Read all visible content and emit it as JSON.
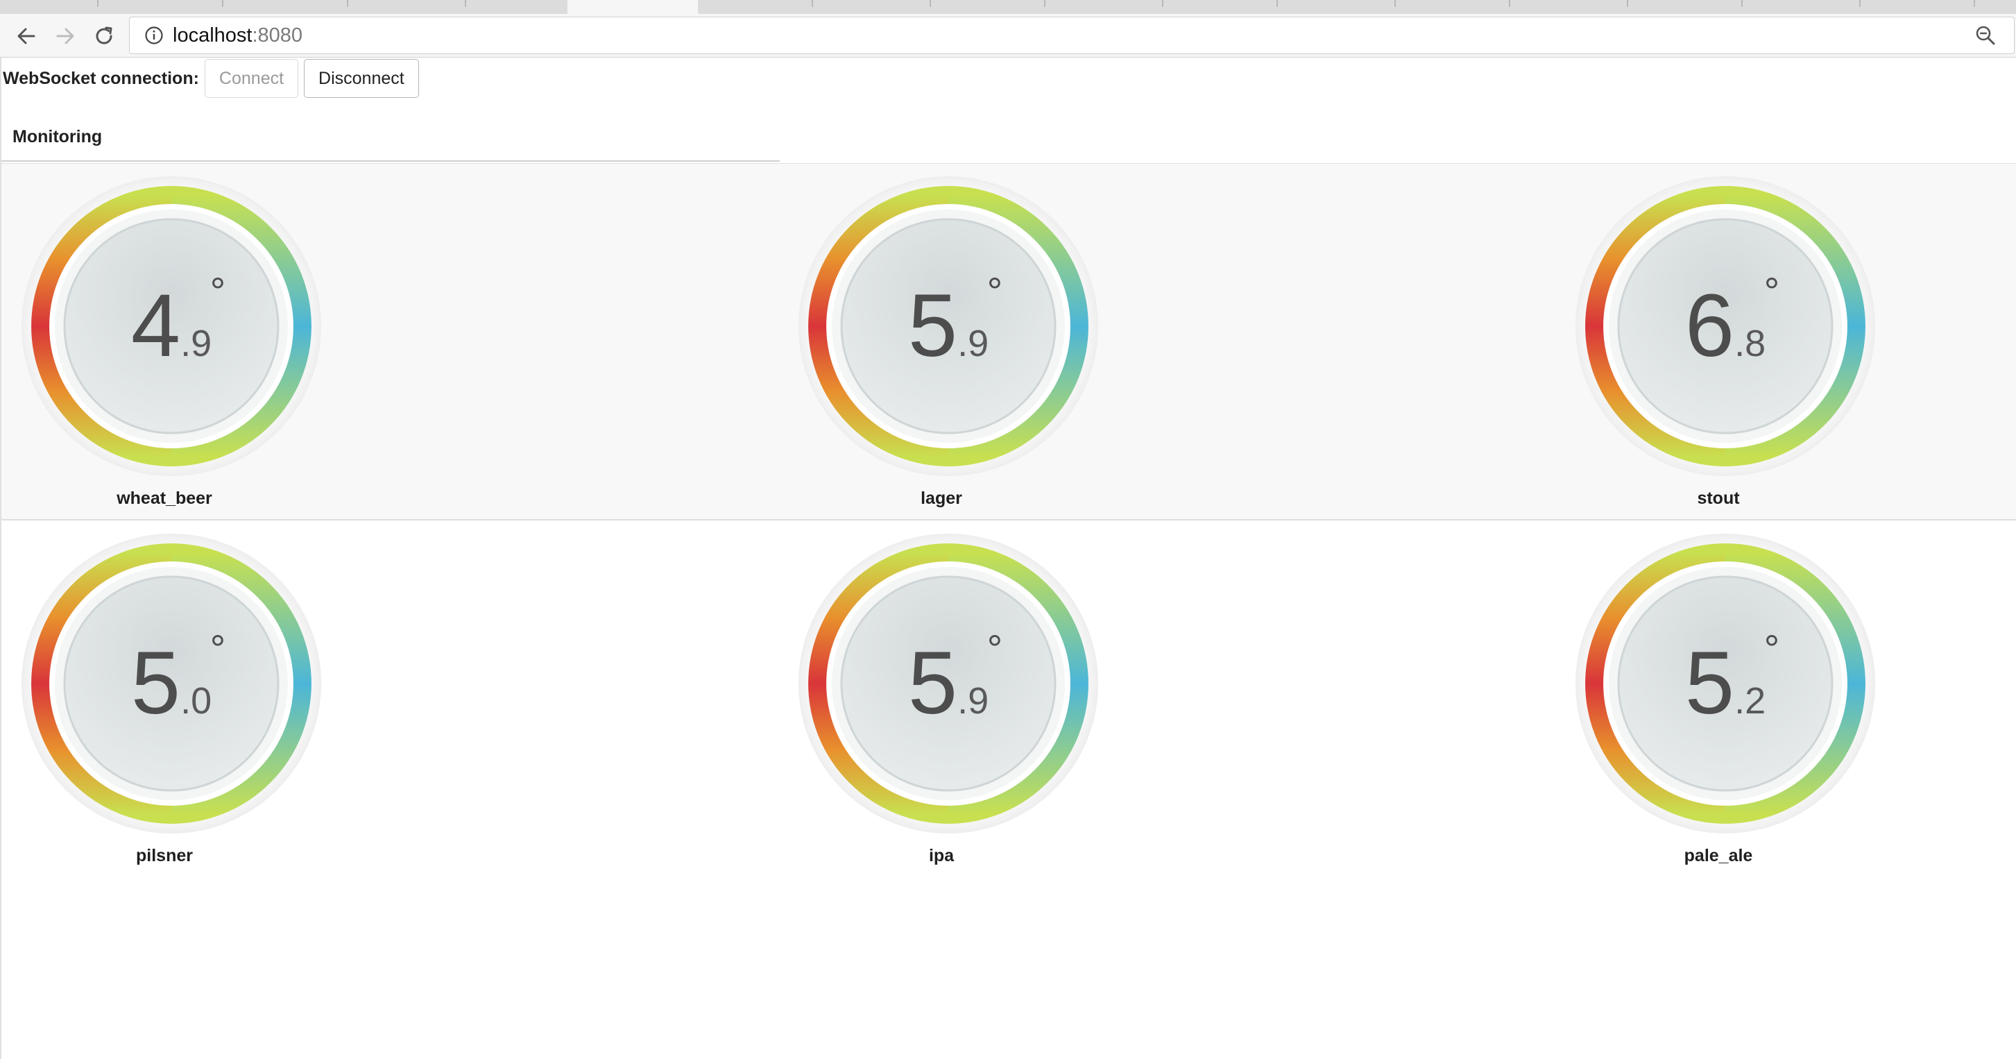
{
  "browser": {
    "url_host": "localhost",
    "url_port": ":8080",
    "icons": {
      "back": "back-arrow-icon",
      "forward": "forward-arrow-icon",
      "reload": "reload-icon",
      "info": "info-icon",
      "zoom": "zoom-icon"
    }
  },
  "websocket": {
    "label": "WebSocket connection:",
    "connect_label": "Connect",
    "disconnect_label": "Disconnect"
  },
  "section": {
    "title": "Monitoring"
  },
  "gauges": [
    {
      "name": "wheat_beer",
      "int": "4",
      "dec": ".9",
      "unit": "°"
    },
    {
      "name": "lager",
      "int": "5",
      "dec": ".9",
      "unit": "°"
    },
    {
      "name": "stout",
      "int": "6",
      "dec": ".8",
      "unit": "°"
    },
    {
      "name": "pilsner",
      "int": "5",
      "dec": ".0",
      "unit": "°"
    },
    {
      "name": "ipa",
      "int": "5",
      "dec": ".9",
      "unit": "°"
    },
    {
      "name": "pale_ale",
      "int": "5",
      "dec": ".2",
      "unit": "°"
    }
  ],
  "colors": {
    "ring_red": "#d9353a",
    "ring_orange": "#e8902d",
    "ring_yellowgreen": "#c8e050",
    "ring_cyan": "#4cb6d8",
    "dial_face": "#dfe3e4",
    "row_highlight": "#f8f8f8"
  }
}
